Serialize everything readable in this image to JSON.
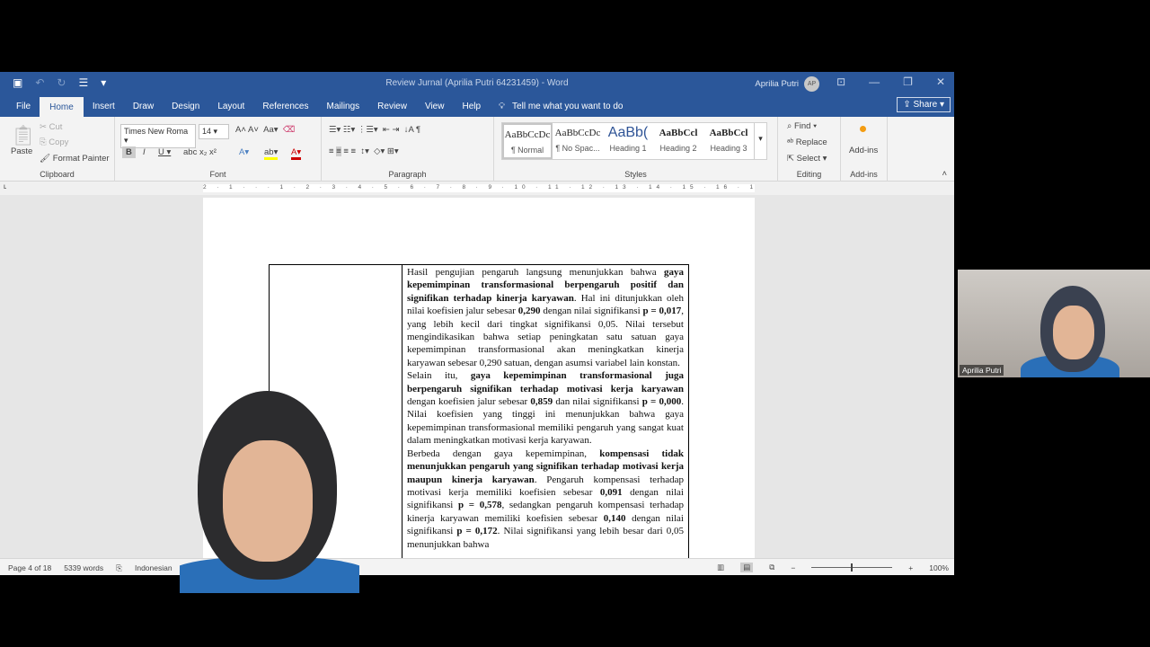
{
  "window": {
    "title": "Review Jurnal (Aprilia Putri 64231459)  -  Word",
    "user": "Aprilia Putri",
    "user_initials": "AP"
  },
  "tabs": [
    "File",
    "Home",
    "Insert",
    "Draw",
    "Design",
    "Layout",
    "References",
    "Mailings",
    "Review",
    "View",
    "Help"
  ],
  "tell_me": "Tell me what you want to do",
  "share": "Share",
  "ribbon": {
    "clipboard": {
      "paste": "Paste",
      "cut": "Cut",
      "copy": "Copy",
      "format_painter": "Format Painter",
      "label": "Clipboard"
    },
    "font": {
      "name": "Times New Roma",
      "size": "14",
      "label": "Font"
    },
    "paragraph": {
      "label": "Paragraph"
    },
    "styles": {
      "items": [
        {
          "preview": "AaBbCcDc",
          "name": "¶ Normal"
        },
        {
          "preview": "AaBbCcDc",
          "name": "¶ No Spac..."
        },
        {
          "preview": "AaBb(",
          "name": "Heading 1"
        },
        {
          "preview": "AaBbCcl",
          "name": "Heading 2"
        },
        {
          "preview": "AaBbCcl",
          "name": "Heading 3"
        }
      ],
      "label": "Styles"
    },
    "editing": {
      "find": "Find",
      "replace": "Replace",
      "select": "Select",
      "label": "Editing"
    },
    "addins": {
      "button": "Add-ins",
      "label": "Add-ins"
    }
  },
  "ruler": "2 · 1 · · · 1 · 2 · 3 · 4 · 5 · 6 · 7 · 8 · 9 · 10 · 11 · 12 · 13 · 14 · 15 · 16 · 17 · 18",
  "document": {
    "paragraphs": [
      [
        {
          "t": "Hasil pengujian pengaruh langsung menunjukkan bahwa "
        },
        {
          "t": "gaya kepemimpinan transformasional berpengaruh positif dan signifikan terhadap kinerja karyawan",
          "b": true
        },
        {
          "t": ". Hal ini ditunjukkan oleh nilai koefisien jalur sebesar "
        },
        {
          "t": "0,290",
          "b": true
        },
        {
          "t": " dengan nilai signifikansi "
        },
        {
          "t": "p = 0,017",
          "b": true
        },
        {
          "t": ", yang lebih kecil dari tingkat signifikansi 0,05. Nilai tersebut mengindikasikan bahwa setiap peningkatan satu satuan gaya kepemimpinan transformasional akan meningkatkan kinerja karyawan sebesar 0,290 satuan, dengan asumsi variabel lain konstan."
        }
      ],
      [
        {
          "t": "Selain itu, "
        },
        {
          "t": "gaya kepemimpinan transformasional juga berpengaruh signifikan terhadap motivasi kerja karyawan",
          "b": true
        },
        {
          "t": " dengan koefisien jalur sebesar "
        },
        {
          "t": "0,859",
          "b": true
        },
        {
          "t": " dan nilai signifikansi "
        },
        {
          "t": "p = 0,000",
          "b": true
        },
        {
          "t": ". Nilai koefisien yang tinggi ini menunjukkan bahwa gaya kepemimpinan transformasional memiliki pengaruh yang sangat kuat dalam meningkatkan motivasi kerja karyawan."
        }
      ],
      [
        {
          "t": "Berbeda dengan gaya kepemimpinan, "
        },
        {
          "t": "kompensasi tidak menunjukkan pengaruh yang signifikan terhadap motivasi kerja maupun kinerja karyawan",
          "b": true
        },
        {
          "t": ". Pengaruh kompensasi terhadap motivasi kerja memiliki koefisien sebesar "
        },
        {
          "t": "0,091",
          "b": true
        },
        {
          "t": " dengan nilai signifikansi "
        },
        {
          "t": "p = 0,578",
          "b": true
        },
        {
          "t": ", sedangkan pengaruh kompensasi terhadap kinerja karyawan memiliki koefisien sebesar "
        },
        {
          "t": "0,140",
          "b": true
        },
        {
          "t": " dengan nilai signifikansi "
        },
        {
          "t": "p = 0,172",
          "b": true
        },
        {
          "t": ". Nilai signifikansi yang lebih besar dari 0,05 menunjukkan bahwa"
        }
      ]
    ]
  },
  "status": {
    "page": "Page 4 of 18",
    "words": "5339 words",
    "language": "Indonesian",
    "zoom": "100%",
    "zoom_fraction": 0.5
  },
  "webcam": {
    "name": "Aprilia Putri"
  }
}
